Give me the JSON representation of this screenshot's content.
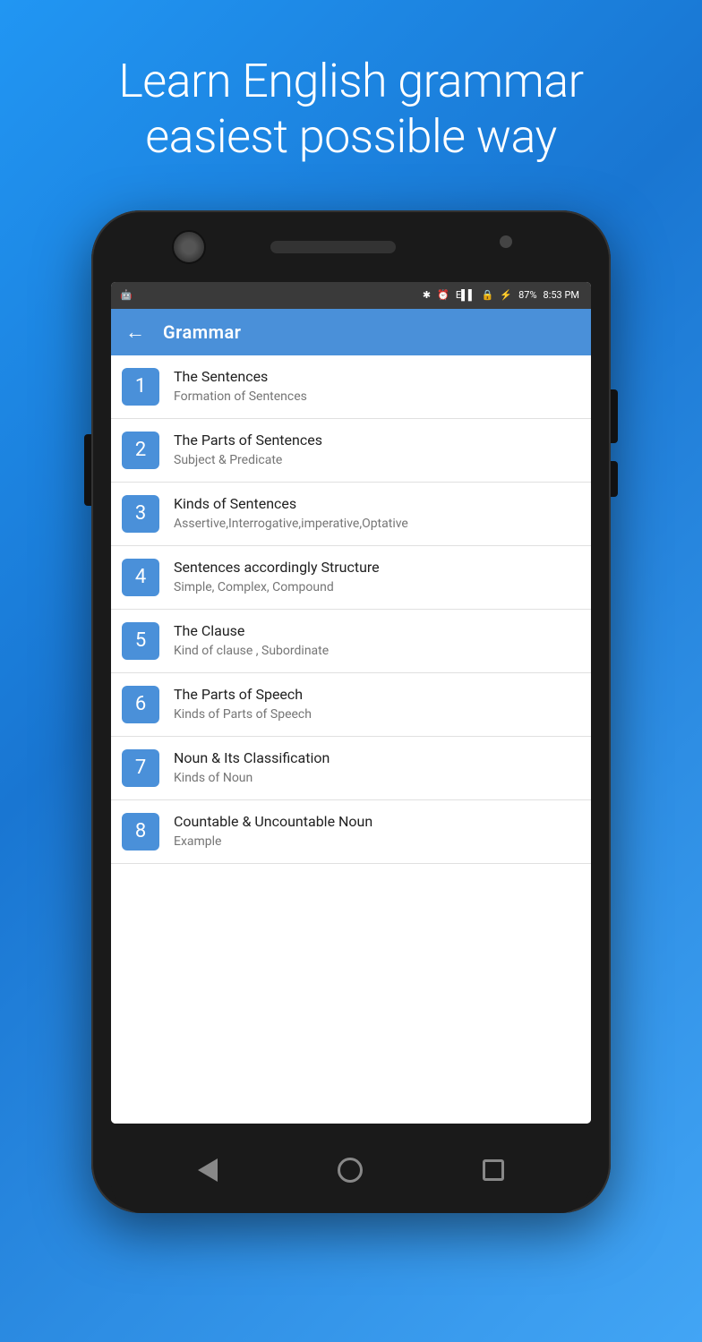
{
  "hero": {
    "line1": "Learn English grammar",
    "line2": "easiest possible way"
  },
  "status_bar": {
    "time": "8:53 PM",
    "battery": "87%",
    "signal": "E"
  },
  "app_bar": {
    "title": "Grammar",
    "back_label": "←"
  },
  "list_items": [
    {
      "number": "1",
      "title": "The Sentences",
      "subtitle": "Formation of Sentences"
    },
    {
      "number": "2",
      "title": "The Parts of Sentences",
      "subtitle": "Subject & Predicate"
    },
    {
      "number": "3",
      "title": "Kinds of Sentences",
      "subtitle": "Assertive,Interrogative,imperative,Optative"
    },
    {
      "number": "4",
      "title": "Sentences accordingly Structure",
      "subtitle": "Simple, Complex, Compound"
    },
    {
      "number": "5",
      "title": "The Clause",
      "subtitle": "Kind of clause , Subordinate"
    },
    {
      "number": "6",
      "title": "The Parts of Speech",
      "subtitle": "Kinds of Parts of Speech"
    },
    {
      "number": "7",
      "title": "Noun & Its Classification",
      "subtitle": "Kinds of Noun"
    },
    {
      "number": "8",
      "title": "Countable & Uncountable Noun",
      "subtitle": "Example"
    }
  ]
}
